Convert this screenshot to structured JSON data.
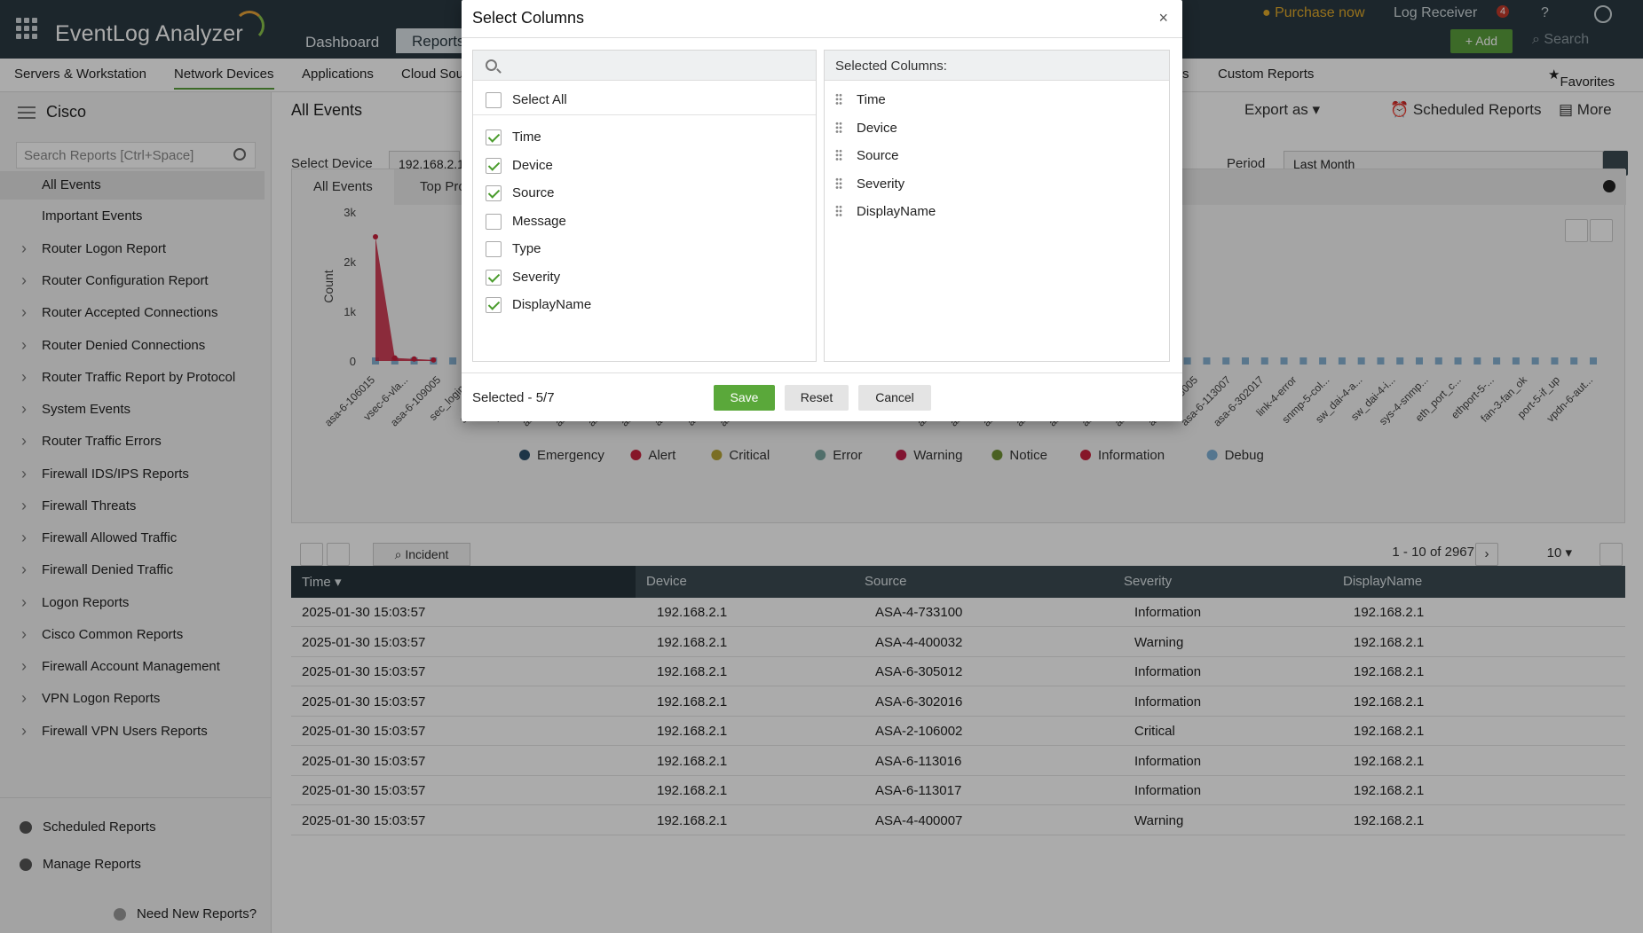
{
  "app": {
    "name": "EventLog Analyzer"
  },
  "header": {
    "tabs": [
      {
        "label": "Dashboard"
      },
      {
        "label": "Reports"
      }
    ],
    "purchase": "Purchase now",
    "log_receiver": "Log Receiver",
    "notif_count": "4",
    "help": "?",
    "add_label": "Add",
    "search_label": "Search"
  },
  "subnav": {
    "items": [
      "Servers & Workstation",
      "Network Devices",
      "Applications",
      "Cloud Sou",
      "s",
      "Custom Reports"
    ],
    "favorites": "Favorites"
  },
  "sidebar": {
    "title": "Cisco",
    "search_placeholder": "Search Reports [Ctrl+Space]",
    "items": [
      "All Events",
      "Important Events",
      "Router Logon Report",
      "Router Configuration Report",
      "Router Accepted Connections",
      "Router Denied Connections",
      "Router Traffic Report by Protocol",
      "System Events",
      "Router Traffic Errors",
      "Firewall IDS/IPS Reports",
      "Firewall Threats",
      "Firewall Allowed Traffic",
      "Firewall Denied Traffic",
      "Logon Reports",
      "Cisco Common Reports",
      "Firewall Account Management",
      "VPN Logon Reports",
      "Firewall VPN Users Reports"
    ],
    "bottom": [
      "Scheduled Reports",
      "Manage Reports",
      "Need New Reports?"
    ]
  },
  "main": {
    "title": "All Events",
    "export": "Export as",
    "scheduled": "Scheduled Reports",
    "more": "More",
    "select_device_label": "Select Device",
    "device_value": "192.168.2.1",
    "period_label": "Period",
    "period_value": "Last Month",
    "chart_tabs": [
      "All Events",
      "Top Pro"
    ],
    "incident_label": "Incident",
    "pager": "1 - 10 of 2967",
    "per_page": "10"
  },
  "chart_data": {
    "type": "line",
    "ylabel": "Count",
    "ylim": [
      0,
      3000
    ],
    "yticks": [
      "0",
      "1k",
      "2k",
      "3k"
    ],
    "x_ticks": [
      "asa-6-106015",
      "vsec-6-vla...",
      "asa-6-109005",
      "sec_login-...",
      "ssh-5-ssh2...",
      "ngwc_platf...",
      "asa-2-106001",
      "asa-2-106006",
      "asa-4-400032",
      "asa-6-109003",
      "asa-6-113004",
      "asa-6-113016",
      "asa-6-302014",
      "ethport-5-...",
      "ip_vfr-3-i...",
      "ip_vfr-4-t...",
      "ssh-5-ssh...",
      "vsec-6-vla...",
      "asa-4-400007",
      "asa-4-400009",
      "asa-4-400023",
      "asa-4-400025",
      "asa-4-400027",
      "asa-4-400033",
      "asa-4-400050",
      "asa-6-113005",
      "asa-6-113007",
      "asa-6-302017",
      "link-4-error",
      "snmp-5-col...",
      "sw_dai-4-a...",
      "sw_dai-4-i...",
      "sys-4-snmp...",
      "eth_port_c...",
      "ethport-5-...",
      "fan-3-fan_ok",
      "port-5-if_up",
      "vpdn-6-aut..."
    ],
    "series": [
      {
        "name": "Emergency",
        "color": "#2c4f6b"
      },
      {
        "name": "Alert",
        "color": "#c8213c"
      },
      {
        "name": "Critical",
        "color": "#b7a437"
      },
      {
        "name": "Error",
        "color": "#7aa6a0"
      },
      {
        "name": "Warning",
        "color": "#c11f4a"
      },
      {
        "name": "Notice",
        "color": "#6f9133"
      },
      {
        "name": "Information",
        "color": "#c8213c",
        "values": [
          2500,
          60,
          40,
          20
        ]
      },
      {
        "name": "Debug",
        "color": "#7fb0d6"
      }
    ]
  },
  "table": {
    "columns": [
      "Time",
      "Device",
      "Source",
      "Severity",
      "DisplayName"
    ],
    "rows": [
      [
        "2025-01-30 15:03:57",
        "192.168.2.1",
        "ASA-4-733100",
        "Information",
        "192.168.2.1"
      ],
      [
        "2025-01-30 15:03:57",
        "192.168.2.1",
        "ASA-4-400032",
        "Warning",
        "192.168.2.1"
      ],
      [
        "2025-01-30 15:03:57",
        "192.168.2.1",
        "ASA-6-305012",
        "Information",
        "192.168.2.1"
      ],
      [
        "2025-01-30 15:03:57",
        "192.168.2.1",
        "ASA-6-302016",
        "Information",
        "192.168.2.1"
      ],
      [
        "2025-01-30 15:03:57",
        "192.168.2.1",
        "ASA-2-106002",
        "Critical",
        "192.168.2.1"
      ],
      [
        "2025-01-30 15:03:57",
        "192.168.2.1",
        "ASA-6-113016",
        "Information",
        "192.168.2.1"
      ],
      [
        "2025-01-30 15:03:57",
        "192.168.2.1",
        "ASA-6-113017",
        "Information",
        "192.168.2.1"
      ],
      [
        "2025-01-30 15:03:57",
        "192.168.2.1",
        "ASA-4-400007",
        "Warning",
        "192.168.2.1"
      ]
    ]
  },
  "modal": {
    "title": "Select Columns",
    "close": "×",
    "select_all": "Select All",
    "options": [
      {
        "label": "Time",
        "checked": true
      },
      {
        "label": "Device",
        "checked": true
      },
      {
        "label": "Source",
        "checked": true
      },
      {
        "label": "Message",
        "checked": false
      },
      {
        "label": "Type",
        "checked": false
      },
      {
        "label": "Severity",
        "checked": true
      },
      {
        "label": "DisplayName",
        "checked": true
      }
    ],
    "selected_header": "Selected Columns:",
    "selected": [
      "Time",
      "Device",
      "Source",
      "Severity",
      "DisplayName"
    ],
    "selected_count": "Selected - 5/7",
    "save": "Save",
    "reset": "Reset",
    "cancel": "Cancel"
  }
}
